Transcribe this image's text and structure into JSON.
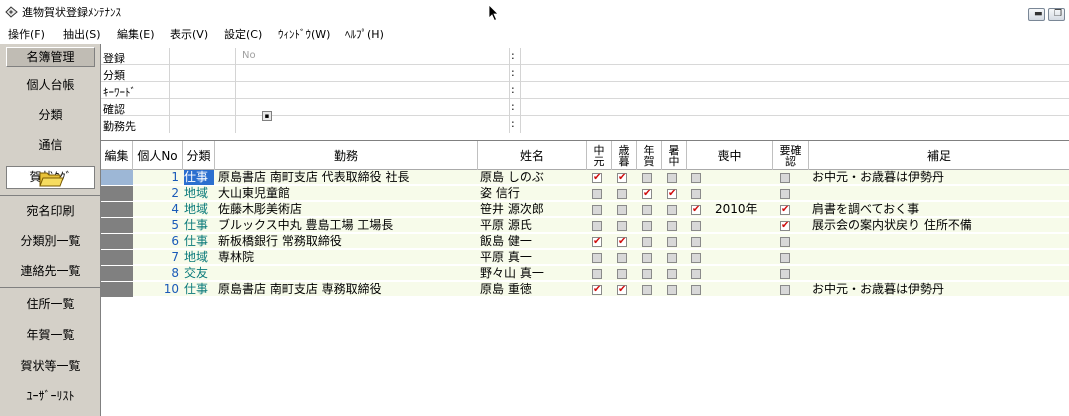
{
  "window": {
    "title": "進物賀状登録ﾒﾝﾃﾅﾝｽ"
  },
  "menu": [
    "操作(F)",
    "抽出(S)",
    "編集(E)",
    "表示(V)",
    "設定(C)",
    "ｳｨﾝﾄﾞｳ(W)",
    "ﾍﾙﾌﾟ(H)"
  ],
  "sidebar": {
    "header": "名簿管理",
    "items": [
      "個人台帳",
      "分類",
      "通信"
    ],
    "card": "賀状ﾀｸﾞ",
    "items2": [
      "宛名印刷",
      "分類別一覧",
      "連絡先一覧"
    ],
    "items3": [
      "住所一覧",
      "年賀一覧",
      "賀状等一覧",
      "ﾕｰｻﾞｰﾘｽﾄ"
    ]
  },
  "criteria": {
    "labels": [
      "登録",
      "分類",
      "ｷｰﾜｰﾄﾞ",
      "確認",
      "勤務先"
    ],
    "no_placeholder": "No",
    "colon": ":"
  },
  "table": {
    "headers": {
      "edit": "編集",
      "no": "個人No",
      "cls": "分類",
      "work": "勤務",
      "name": "姓名",
      "chugen": [
        "中",
        "元"
      ],
      "seibo": [
        "歳",
        "暮"
      ],
      "nenga": [
        "年",
        "賀"
      ],
      "shochu": [
        "暑",
        "中"
      ],
      "mochu": "喪中",
      "kakunin": [
        "要確",
        "認"
      ],
      "hosoku": "補足"
    },
    "rows": [
      {
        "no": "1",
        "cls": "仕事",
        "work": "原島書店 南町支店 代表取締役 社長",
        "name": "原島 しのぶ",
        "chugen": true,
        "seibo": true,
        "nenga": false,
        "shochu": false,
        "mochu": false,
        "mochu_year": "",
        "kakunin": false,
        "note": "お中元・お歳暮は伊勢丹"
      },
      {
        "no": "2",
        "cls": "地域",
        "work": "大山東児童館",
        "name": "姿 信行",
        "chugen": false,
        "seibo": false,
        "nenga": true,
        "shochu": true,
        "mochu": false,
        "mochu_year": "",
        "kakunin": false,
        "note": ""
      },
      {
        "no": "4",
        "cls": "地域",
        "work": "佐藤木彫美術店",
        "name": "笹井 源次郎",
        "chugen": false,
        "seibo": false,
        "nenga": false,
        "shochu": false,
        "mochu": true,
        "mochu_year": "2010年",
        "kakunin": true,
        "note": "肩書を調べておく事"
      },
      {
        "no": "5",
        "cls": "仕事",
        "work": "ブルックス中丸 豊島工場 工場長",
        "name": "平原 源氏",
        "chugen": false,
        "seibo": false,
        "nenga": false,
        "shochu": false,
        "mochu": false,
        "mochu_year": "",
        "kakunin": true,
        "note": "展示会の案内状戻り  住所不備"
      },
      {
        "no": "6",
        "cls": "仕事",
        "work": "新板橋銀行    常務取締役",
        "name": "飯島 健一",
        "chugen": true,
        "seibo": true,
        "nenga": false,
        "shochu": false,
        "mochu": false,
        "mochu_year": "",
        "kakunin": false,
        "note": ""
      },
      {
        "no": "7",
        "cls": "地域",
        "work": "専林院",
        "name": "平原 真一",
        "chugen": false,
        "seibo": false,
        "nenga": false,
        "shochu": false,
        "mochu": false,
        "mochu_year": "",
        "kakunin": false,
        "note": ""
      },
      {
        "no": "8",
        "cls": "交友",
        "work": "",
        "name": "野々山 真一",
        "chugen": false,
        "seibo": false,
        "nenga": false,
        "shochu": false,
        "mochu": false,
        "mochu_year": "",
        "kakunin": false,
        "note": ""
      },
      {
        "no": "10",
        "cls": "仕事",
        "work": "原島書店 南町支店 専務取締役",
        "name": "原島 重徳",
        "chugen": true,
        "seibo": true,
        "nenga": false,
        "shochu": false,
        "mochu": false,
        "mochu_year": "",
        "kakunin": false,
        "note": "お中元・お歳暮は伊勢丹"
      }
    ]
  },
  "colors": {
    "sidebar": "#d4d0c8",
    "row_bg": "#f7fbea",
    "check_red": "#d01010",
    "no_blue": "#1a5ab8",
    "class_teal": "#0a7a7a"
  },
  "icons": [
    "app-icon",
    "folder-icon",
    "checkmark-icon"
  ]
}
